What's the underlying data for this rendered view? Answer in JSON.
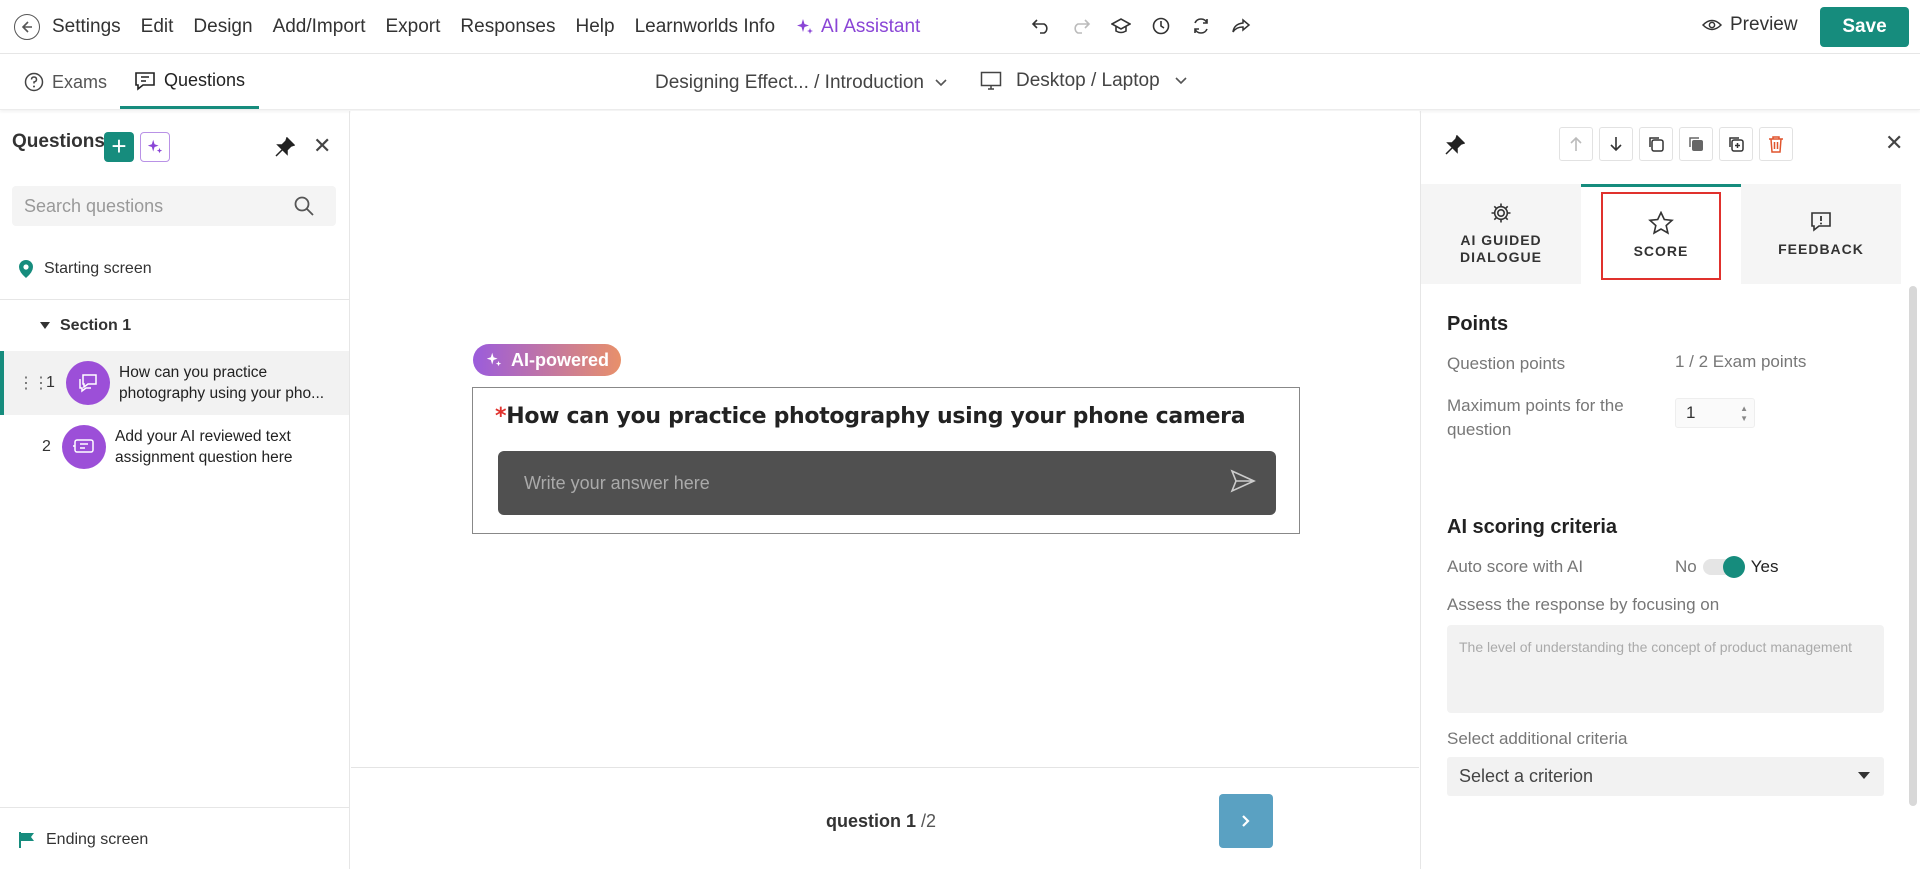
{
  "topbar": {
    "menu": [
      "Settings",
      "Edit",
      "Design",
      "Add/Import",
      "Export",
      "Responses",
      "Help",
      "Learnworlds Info"
    ],
    "ai_assistant": "AI Assistant",
    "preview": "Preview",
    "save": "Save"
  },
  "subbar": {
    "tab_exams": "Exams",
    "tab_questions": "Questions",
    "breadcrumb": "Designing Effect... / Introduction",
    "device": "Desktop / Laptop"
  },
  "left": {
    "title": "Questions",
    "search_placeholder": "Search questions",
    "starting_screen": "Starting screen",
    "section": "Section 1",
    "questions": [
      {
        "num": "1",
        "text": "How can you practice photography using your pho..."
      },
      {
        "num": "2",
        "text": "Add your AI reviewed text assignment question here"
      }
    ],
    "ending_screen": "Ending screen"
  },
  "canvas": {
    "badge": "AI-powered",
    "required_mark": "*",
    "question": "How can you practice photography using your phone camera",
    "answer_placeholder": "Write your answer here",
    "counter_current": "question 1",
    "counter_total": "/2"
  },
  "right": {
    "tabs": {
      "dialogue": "AI GUIDED DIALOGUE",
      "score": "SCORE",
      "feedback": "FEEDBACK"
    },
    "points_heading": "Points",
    "question_points_label": "Question points",
    "question_points_value": "1 / 2 Exam points",
    "max_points_label": "Maximum points for the question",
    "max_points_value": "1",
    "ai_heading": "AI scoring criteria",
    "auto_score_label": "Auto score with AI",
    "toggle_no": "No",
    "toggle_yes": "Yes",
    "assess_label": "Assess the response by focusing on",
    "assess_placeholder": "The level of understanding the concept of product management",
    "additional_label": "Select additional criteria",
    "criterion_select": "Select a criterion"
  },
  "colors": {
    "accent": "#168c7d",
    "ai_purple": "#8a45d6",
    "highlight": "#e0312d",
    "next": "#5aa1c2"
  }
}
